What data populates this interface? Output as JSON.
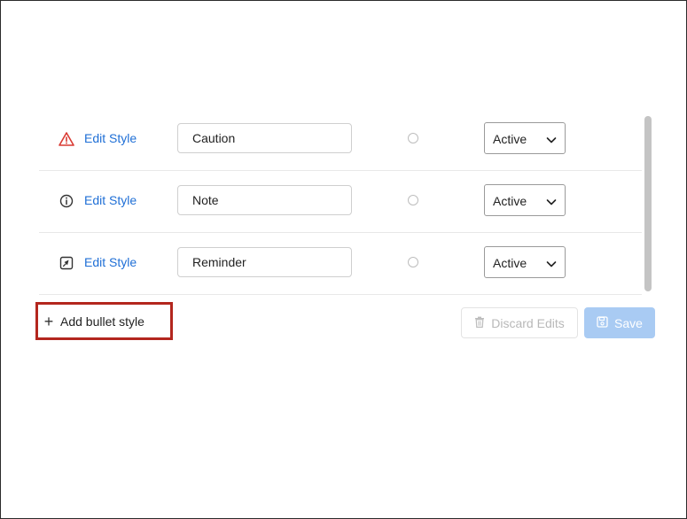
{
  "styles": [
    {
      "icon": "warning-triangle-icon",
      "edit_label": "Edit Style",
      "name": "Caution",
      "status": "Active"
    },
    {
      "icon": "info-circle-icon",
      "edit_label": "Edit Style",
      "name": "Note",
      "status": "Active"
    },
    {
      "icon": "pin-square-icon",
      "edit_label": "Edit Style",
      "name": "Reminder",
      "status": "Active"
    }
  ],
  "actions": {
    "add_label": "Add bullet style",
    "discard_label": "Discard Edits",
    "save_label": "Save"
  },
  "colors": {
    "link": "#1f6fd6",
    "caution": "#d93a32",
    "highlight_box": "#b3261e",
    "save_disabled": "#a9cbf3"
  }
}
